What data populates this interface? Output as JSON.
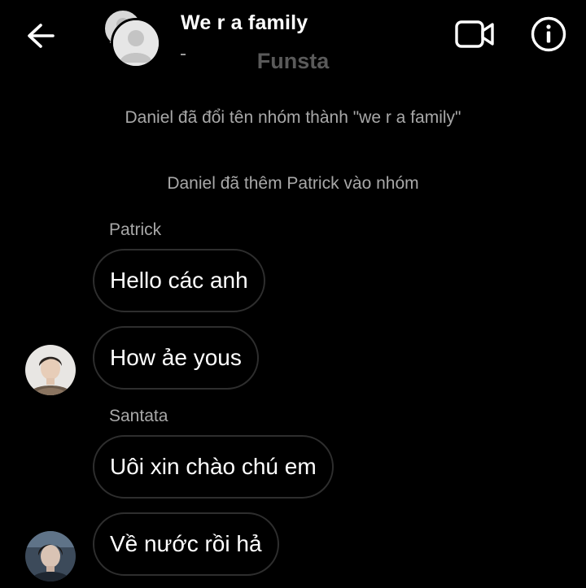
{
  "header": {
    "title": "We r a family",
    "back_icon": "arrow-left-icon",
    "video_icon": "video-call-icon",
    "info_icon": "info-icon"
  },
  "banner": {
    "label": "Funsta"
  },
  "system_messages": [
    "Daniel đã đổi tên nhóm thành \"we r a family\"",
    "Daniel đã thêm Patrick vào nhóm"
  ],
  "messages": [
    {
      "sender": "Patrick",
      "text": "Hello các anh"
    },
    {
      "sender": "",
      "text": "How ảe yous"
    },
    {
      "sender": "Santata",
      "text": "Uôi xin chào chú em"
    },
    {
      "sender": "",
      "text": "Về nước rồi hả"
    }
  ],
  "colors": {
    "background": "#000000",
    "bubble_border": "#2e2e2e",
    "muted_text": "#a8a8a8",
    "banner_text": "#5a5a5a"
  }
}
